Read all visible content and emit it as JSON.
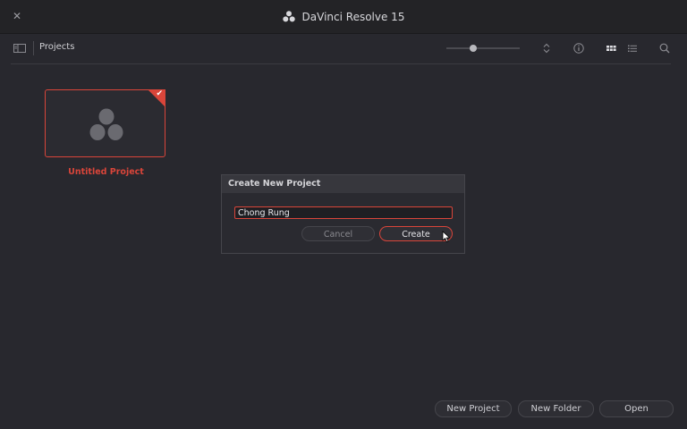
{
  "window": {
    "title": "DaVinci Resolve 15"
  },
  "toolbar": {
    "breadcrumb": "Projects",
    "zoom_level": 0.37
  },
  "projects": [
    {
      "name": "Untitled Project",
      "selected": true
    }
  ],
  "dialog": {
    "title": "Create New Project",
    "input_value": "Chong Rung",
    "cancel_label": "Cancel",
    "create_label": "Create"
  },
  "footer": {
    "new_project_label": "New Project",
    "new_folder_label": "New Folder",
    "open_label": "Open"
  },
  "colors": {
    "accent": "#d9453a",
    "background": "#28282e",
    "titlebar": "#232326"
  },
  "icons": {
    "close": "close-icon",
    "logo": "davinci-logo-icon",
    "panel": "sidebar-toggle-icon",
    "sort": "sort-icon",
    "info": "info-icon",
    "grid": "grid-view-icon",
    "list": "list-view-icon",
    "search": "search-icon"
  }
}
